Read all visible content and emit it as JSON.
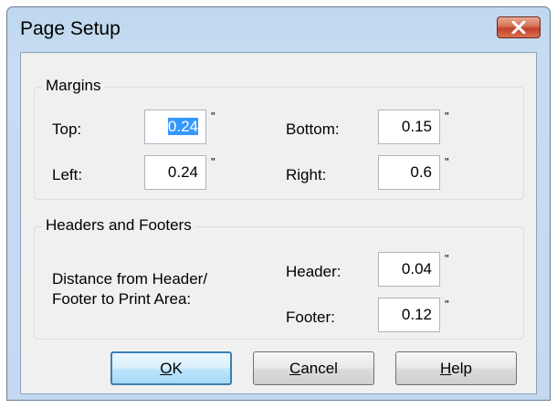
{
  "window": {
    "title": "Page Setup"
  },
  "margins": {
    "label": "Margins",
    "top_label": "Top:",
    "top_value": "0.24",
    "left_label": "Left:",
    "left_value": "0.24",
    "bottom_label": "Bottom:",
    "bottom_value": "0.15",
    "right_label": "Right:",
    "right_value": "0.6"
  },
  "headers_footers": {
    "label": "Headers and Footers",
    "description_line1": "Distance from Header/",
    "description_line2": "Footer to Print Area:",
    "header_label": "Header:",
    "header_value": "0.04",
    "footer_label": "Footer:",
    "footer_value": "0.12"
  },
  "unit_symbol": "\"",
  "buttons": {
    "ok_mnemonic": "O",
    "ok_rest": "K",
    "cancel_mnemonic": "C",
    "cancel_rest": "ancel",
    "help_mnemonic": "H",
    "help_rest": "elp"
  },
  "icons": {
    "close": "close-x-icon"
  },
  "colors": {
    "close_button": "#c7452b",
    "selection": "#3399ff",
    "title_bar": "#c3d9ef"
  }
}
